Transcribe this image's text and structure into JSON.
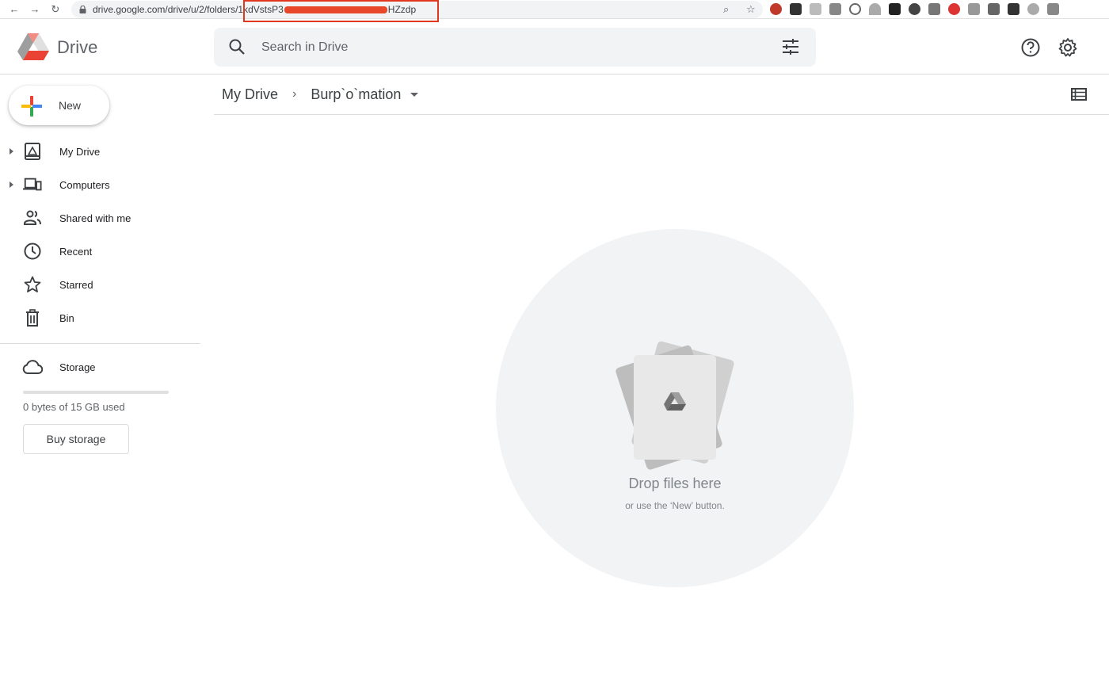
{
  "browser": {
    "url_prefix": "drive.google.com/drive/u/2/folders/1kdVstsP3",
    "url_suffix": "HZzdp"
  },
  "header": {
    "app_name": "Drive",
    "search_placeholder": "Search in Drive"
  },
  "sidebar": {
    "new_label": "New",
    "items": [
      {
        "label": "My Drive",
        "icon": "my-drive-icon",
        "expandable": true
      },
      {
        "label": "Computers",
        "icon": "computers-icon",
        "expandable": true
      },
      {
        "label": "Shared with me",
        "icon": "shared-icon",
        "expandable": false
      },
      {
        "label": "Recent",
        "icon": "clock-icon",
        "expandable": false
      },
      {
        "label": "Starred",
        "icon": "star-icon",
        "expandable": false
      },
      {
        "label": "Bin",
        "icon": "bin-icon",
        "expandable": false
      }
    ],
    "storage_label": "Storage",
    "storage_used": "0 bytes of 15 GB used",
    "storage_fraction": 0,
    "buy_storage_label": "Buy storage"
  },
  "main": {
    "breadcrumb_root": "My Drive",
    "breadcrumb_current": "Burp`o`mation",
    "drop_title": "Drop files here",
    "drop_subtitle": "or use the ‘New’ button."
  },
  "colors": {
    "accent": "#1a73e8",
    "highlight": "#e2371f",
    "drive_yellow": "#f4b400",
    "drive_green": "#0f9d58",
    "drive_red": "#db4437"
  }
}
